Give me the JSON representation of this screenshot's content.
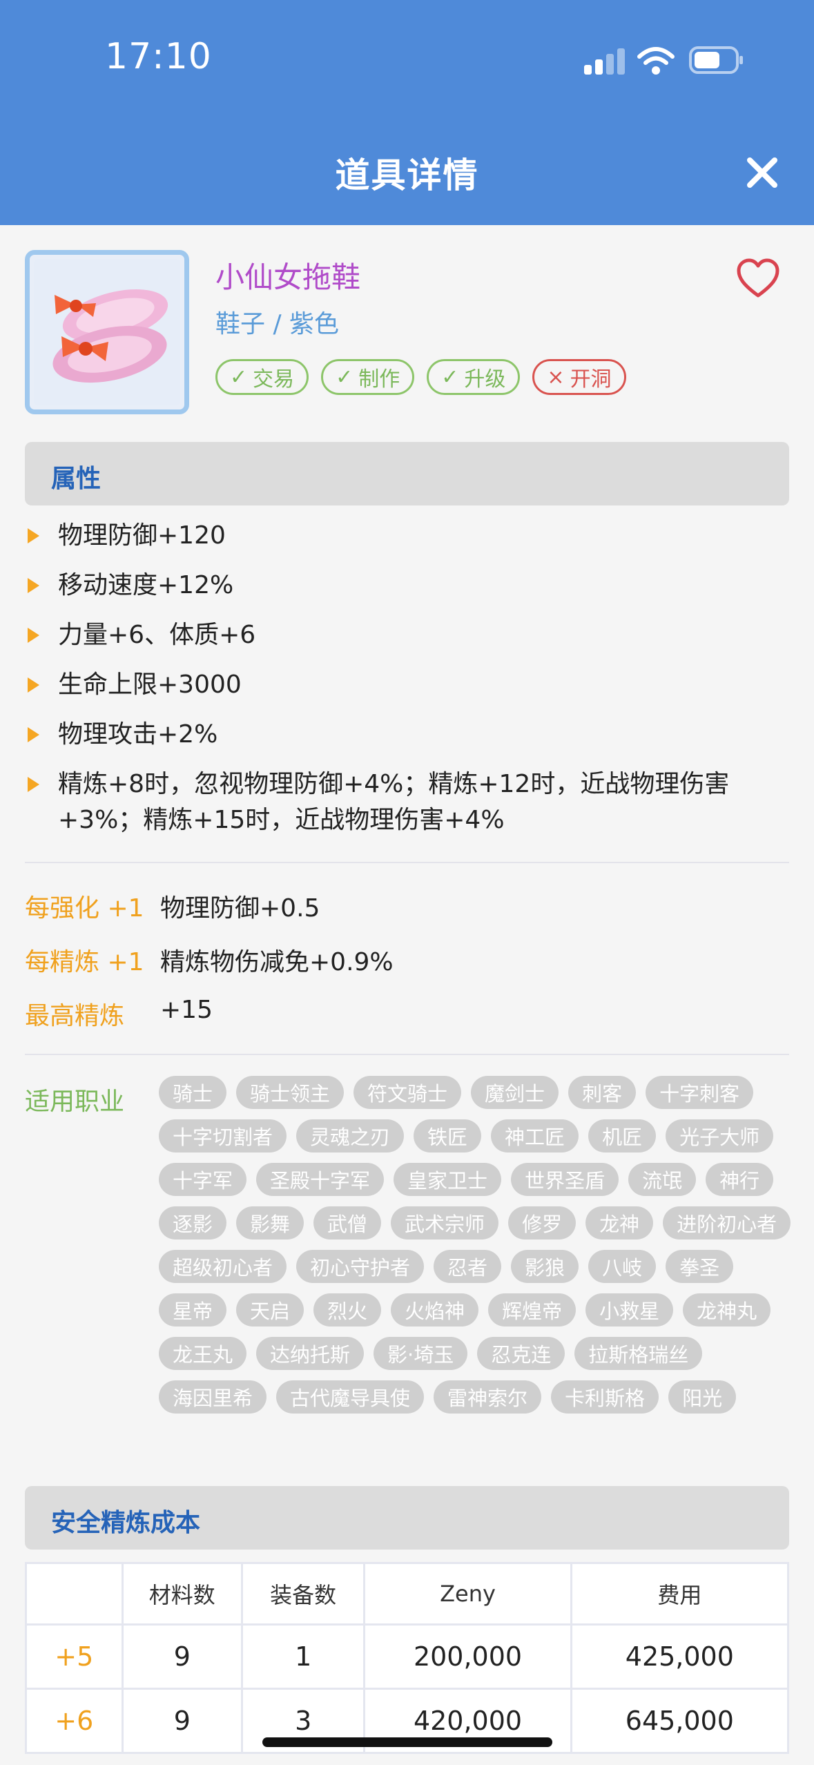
{
  "status_bar": {
    "time": "17:10"
  },
  "header": {
    "title": "道具详情"
  },
  "item": {
    "name": "小仙女拖鞋",
    "type": "鞋子 / 紫色",
    "tags": [
      {
        "label": "交易",
        "allowed": true
      },
      {
        "label": "制作",
        "allowed": true
      },
      {
        "label": "升级",
        "allowed": true
      },
      {
        "label": "开洞",
        "allowed": false
      }
    ]
  },
  "attributes": {
    "title": "属性",
    "items": [
      "物理防御+120",
      "移动速度+12%",
      "力量+6、体质+6",
      "生命上限+3000",
      "物理攻击+2%",
      "精炼+8时，忽视物理防御+4%；精炼+12时，近战物理伤害+3%；精炼+15时，近战物理伤害+4%"
    ]
  },
  "enhance": [
    {
      "key": "每强化 +1",
      "value": "物理防御+0.5"
    },
    {
      "key": "每精炼 +1",
      "value": "精炼物伤减免+0.9%"
    },
    {
      "key": "最高精炼",
      "value": "+15"
    }
  ],
  "jobs": {
    "label": "适用职业",
    "items": [
      "骑士",
      "骑士领主",
      "符文骑士",
      "魔剑士",
      "刺客",
      "十字刺客",
      "十字切割者",
      "灵魂之刃",
      "铁匠",
      "神工匠",
      "机匠",
      "光子大师",
      "十字军",
      "圣殿十字军",
      "皇家卫士",
      "世界圣盾",
      "流氓",
      "神行",
      "逐影",
      "影舞",
      "武僧",
      "武术宗师",
      "修罗",
      "龙神",
      "进阶初心者",
      "超级初心者",
      "初心守护者",
      "忍者",
      "影狼",
      "八岐",
      "拳圣",
      "星帝",
      "天启",
      "烈火",
      "火焰神",
      "辉煌帝",
      "小救星",
      "龙神丸",
      "龙王丸",
      "达纳托斯",
      "影·埼玉",
      "忍克连",
      "拉斯格瑞丝",
      "海因里希",
      "古代魔导具使",
      "雷神索尔",
      "卡利斯格",
      "阳光"
    ]
  },
  "refine_cost": {
    "title": "安全精炼成本",
    "headers": [
      "",
      "材料数",
      "装备数",
      "Zeny",
      "费用"
    ],
    "rows": [
      [
        "+5",
        "9",
        "1",
        "200,000",
        "425,000"
      ],
      [
        "+6",
        "9",
        "3",
        "420,000",
        "645,000"
      ]
    ]
  },
  "colors": {
    "header_bg": "#4f8ad9",
    "accent_orange": "#f0a11e",
    "name_purple": "#b04bc9",
    "job_green": "#7bb85a"
  }
}
